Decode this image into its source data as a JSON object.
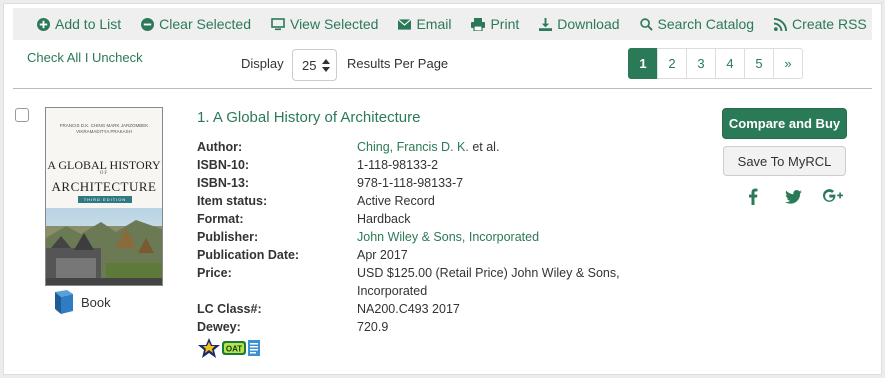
{
  "toolbar": {
    "add_to_list": "Add to List",
    "clear_selected": "Clear Selected",
    "view_selected": "View Selected",
    "email": "Email",
    "print": "Print",
    "download": "Download",
    "search_catalog": "Search Catalog",
    "create_rss": "Create RSS"
  },
  "controls": {
    "check_all": "Check All",
    "separator": " I ",
    "uncheck": "Uncheck",
    "display_label": "Display",
    "per_page_value": "25",
    "results_per_page_label": "Results Per Page"
  },
  "pagination": {
    "pages": [
      "1",
      "2",
      "3",
      "4",
      "5"
    ],
    "next": "»",
    "current": "1"
  },
  "record": {
    "title": "1. A Global History of Architecture",
    "cover": {
      "authors_line": "FRANCIS D.K. CHING  MARK JARZOMBEK  VIKRAMADITYA PRAKASH",
      "title_line1": "A GLOBAL HISTORY",
      "title_of": "OF",
      "title_line2": "ARCHITECTURE",
      "edition": "THIRD EDITION"
    },
    "format_label": "Book",
    "fields": {
      "author_label": "Author:",
      "author_link": "Ching, Francis D. K.",
      "author_suffix": " et al.",
      "isbn10_label": "ISBN-10:",
      "isbn10": "1-118-98133-2",
      "isbn13_label": "ISBN-13:",
      "isbn13": "978-1-118-98133-7",
      "item_status_label": "Item status:",
      "item_status": "Active Record",
      "format_label": "Format:",
      "format": "Hardback",
      "publisher_label": "Publisher:",
      "publisher": "John Wiley & Sons, Incorporated",
      "pubdate_label": "Publication Date:",
      "pubdate": "Apr 2017",
      "price_label": "Price:",
      "price": "USD $125.00 (Retail Price) John Wiley & Sons, Incorporated",
      "lc_label": "LC Class#:",
      "lc": "NA200.C493 2017",
      "dewey_label": "Dewey:",
      "dewey": "720.9"
    },
    "badges": {
      "oat": "OAT"
    }
  },
  "actions": {
    "compare_buy": "Compare and Buy",
    "save_myrcl": "Save To MyRCL"
  },
  "colors": {
    "accent": "#2b7a57",
    "toolbar_bg": "#efefef"
  }
}
